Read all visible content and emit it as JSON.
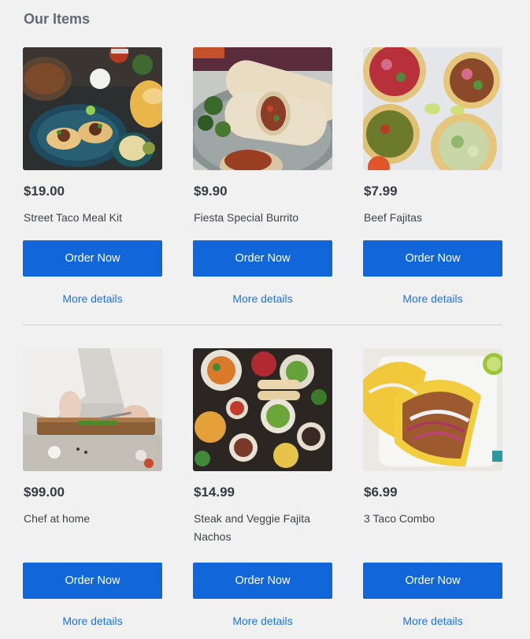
{
  "section": {
    "title": "Our Items"
  },
  "items": [
    {
      "price": "$19.00",
      "name": "Street Taco Meal Kit",
      "button": "Order Now",
      "details": "More details",
      "image": "taco-meal-kit-photo"
    },
    {
      "price": "$9.90",
      "name": "Fiesta Special Burrito",
      "button": "Order Now",
      "details": "More details",
      "image": "burrito-photo"
    },
    {
      "price": "$7.99",
      "name": "Beef Fajitas",
      "button": "Order Now",
      "details": "More details",
      "image": "beef-fajitas-photo"
    },
    {
      "price": "$99.00",
      "name": "Chef at home",
      "button": "Order Now",
      "details": "More details",
      "image": "chef-cutting-photo"
    },
    {
      "price": "$14.99",
      "name": "Steak and Veggie Fajita Nachos",
      "button": "Order Now",
      "details": "More details",
      "image": "fajita-nachos-photo"
    },
    {
      "price": "$6.99",
      "name": "3 Taco Combo",
      "button": "Order Now",
      "details": "More details",
      "image": "taco-combo-photo"
    }
  ],
  "colors": {
    "accent": "#1167d9",
    "link": "#1a73e8",
    "background": "#f1f1f1"
  }
}
